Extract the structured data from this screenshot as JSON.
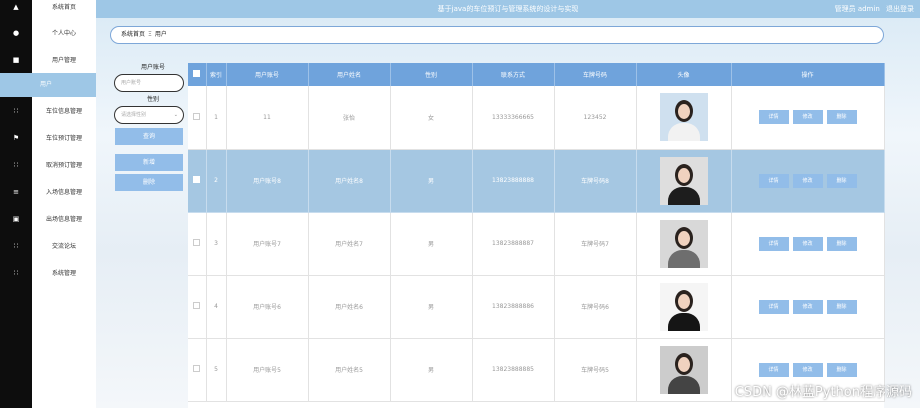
{
  "header": {
    "system_title": "基于java的车位预订与管理系统的设计与实现",
    "user_label": "管理员 admin",
    "logout_label": "退出登录"
  },
  "sidebar": {
    "items": [
      {
        "icon": "home-icon",
        "label": "系统首页"
      },
      {
        "icon": "person-icon",
        "label": "个人中心"
      },
      {
        "icon": "book-icon",
        "label": "用户管理"
      },
      {
        "icon": "",
        "label": "用户"
      },
      {
        "icon": "grid-icon",
        "label": "车位信息管理"
      },
      {
        "icon": "flag-icon",
        "label": "车位预订管理"
      },
      {
        "icon": "grid-icon",
        "label": "取消预订管理"
      },
      {
        "icon": "list-icon",
        "label": "入场信息管理"
      },
      {
        "icon": "square-icon",
        "label": "出场信息管理"
      },
      {
        "icon": "grid-icon",
        "label": "交流论坛"
      },
      {
        "icon": "grid-icon",
        "label": "系统管理"
      }
    ]
  },
  "breadcrumb": {
    "home": "系统首页",
    "separator": "Ξ",
    "current": "用户"
  },
  "search": {
    "account_label": "用户账号",
    "account_placeholder": "用户账号",
    "gender_label": "性别",
    "gender_placeholder": "请选择性别",
    "query_button": "查询",
    "add_button": "新增",
    "delete_button": "删除"
  },
  "table": {
    "columns": [
      "索引",
      "用户账号",
      "用户姓名",
      "性别",
      "联系方式",
      "车牌号码",
      "头像",
      "操作"
    ],
    "rows": [
      {
        "index": "1",
        "account": "11",
        "name": "张怡",
        "gender": "女",
        "phone": "13333366665",
        "plate": "123452"
      },
      {
        "index": "2",
        "account": "用户账号8",
        "name": "用户姓名8",
        "gender": "男",
        "phone": "13823888888",
        "plate": "车牌号码8"
      },
      {
        "index": "3",
        "account": "用户账号7",
        "name": "用户姓名7",
        "gender": "男",
        "phone": "13823888887",
        "plate": "车牌号码7"
      },
      {
        "index": "4",
        "account": "用户账号6",
        "name": "用户姓名6",
        "gender": "男",
        "phone": "13823888886",
        "plate": "车牌号码6"
      },
      {
        "index": "5",
        "account": "用户账号5",
        "name": "用户姓名5",
        "gender": "男",
        "phone": "13823888885",
        "plate": "车牌号码5"
      }
    ],
    "actions": {
      "detail": "详情",
      "edit": "修改",
      "delete": "删除"
    }
  },
  "watermark": "CSDN @林蓝Python程序源码",
  "colors": {
    "accent": "#9ec7e6",
    "header_row": "#6fa3dc",
    "button": "#92bde9",
    "selected_row": "#a5c7e2"
  }
}
